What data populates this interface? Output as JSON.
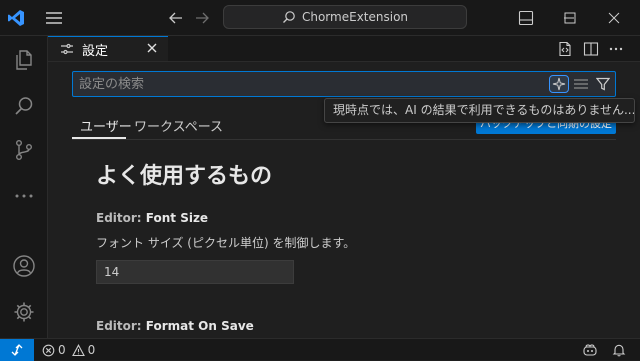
{
  "titlebar": {
    "command_center": "ChormeExtension",
    "icons": [
      "vscode-logo",
      "menu-icon",
      "arrow-left-icon",
      "arrow-right-icon",
      "search-icon",
      "layout-panel-icon",
      "minimize-icon",
      "maximize-icon",
      "close-icon"
    ]
  },
  "activitybar": {
    "items": [
      "explorer-icon",
      "search-icon",
      "source-control-icon",
      "more-icon",
      "account-icon",
      "gear-icon"
    ]
  },
  "editor_tab": {
    "label": "設定",
    "icons": [
      "settings-icon",
      "close-icon"
    ],
    "actions": [
      "open-json-icon",
      "split-editor-icon",
      "more-actions-icon"
    ]
  },
  "settings": {
    "search_placeholder": "設定の検索",
    "scope_tabs": [
      "ユーザー",
      "ワークスペース"
    ],
    "active_scope": "ユーザー",
    "backup_sync_button": "バックアップと同期の設定",
    "tooltip": "現時点では、AI の結果で利用できるものはありません... (Ctrl+I)",
    "section_title": "よく使用するもの",
    "items": [
      {
        "category": "Editor: ",
        "name": "Font Size",
        "description": "フォント サイズ (ピクセル単位) を制御します。",
        "value": "14"
      },
      {
        "category": "Editor: ",
        "name": "Format On Save"
      }
    ]
  },
  "statusbar": {
    "errors": "0",
    "warnings": "0"
  },
  "colors": {
    "accent": "#0078d4",
    "background": "#1f1f1f",
    "chrome": "#181818"
  }
}
